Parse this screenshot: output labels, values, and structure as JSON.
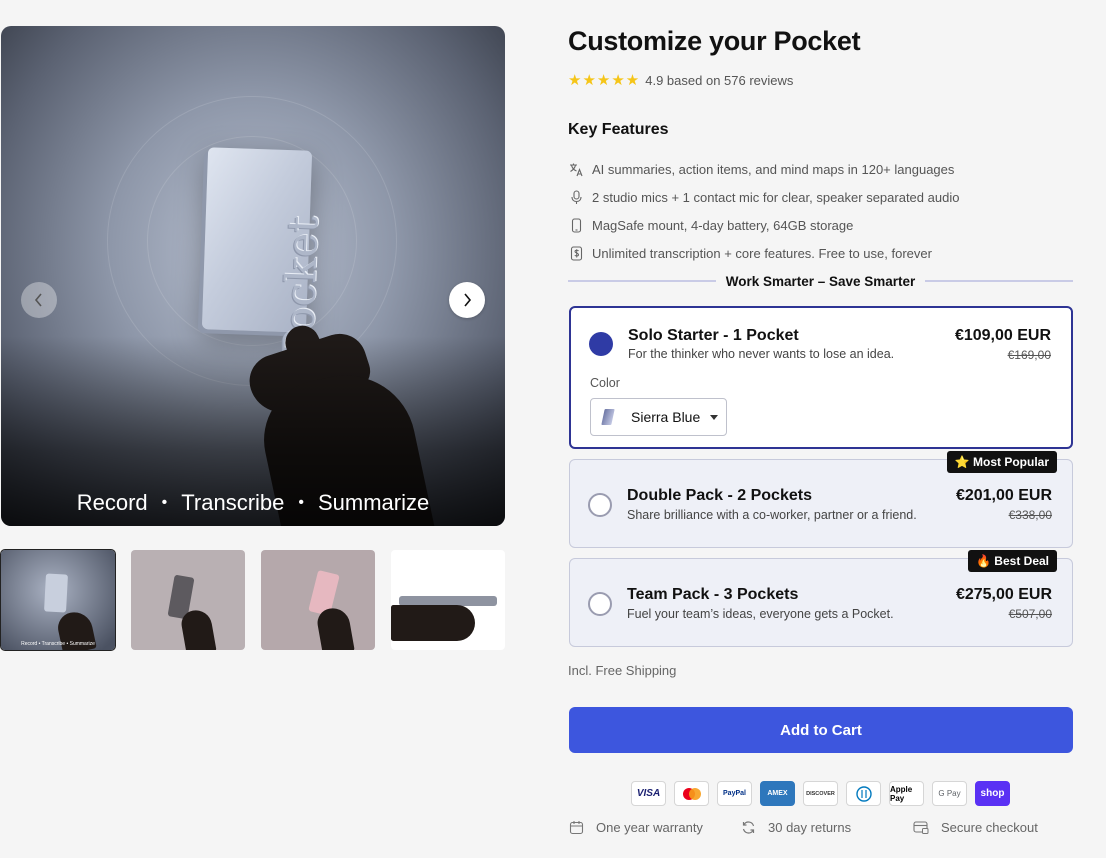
{
  "gallery": {
    "hero_tagline": [
      "Record",
      "Transcribe",
      "Summarize"
    ],
    "tagline_separator": "•",
    "device_wordmark": "Pocket",
    "thumb1_caption": "Record • Transcribe • Summarize",
    "prev_icon": "chevron-left-icon",
    "next_icon": "chevron-right-icon"
  },
  "product": {
    "title": "Customize your Pocket",
    "stars": "★★★★★",
    "rating_text": "4.9 based on 576 reviews"
  },
  "key_features": {
    "title": "Key Features",
    "items": [
      {
        "icon": "translate-icon",
        "text": "AI summaries, action items, and mind maps in 120+ languages"
      },
      {
        "icon": "microphone-icon",
        "text": "2 studio mics + 1 contact mic for clear, speaker separated audio"
      },
      {
        "icon": "phone-icon",
        "text": "MagSafe mount, 4-day battery, 64GB storage"
      },
      {
        "icon": "dollar-icon",
        "text": "Unlimited transcription + core features. Free to use, forever"
      }
    ]
  },
  "offer_divider": "Work Smarter – Save Smarter",
  "plans": [
    {
      "name": "Solo Starter - 1 Pocket",
      "desc": "For the thinker who never wants to lose an idea.",
      "price": "€109,00 EUR",
      "old_price": "€169,00",
      "selected": true,
      "badge": ""
    },
    {
      "name": "Double Pack - 2 Pockets",
      "desc": "Share brilliance with a co-worker, partner or a friend.",
      "price": "€201,00 EUR",
      "old_price": "€338,00",
      "selected": false,
      "badge": "⭐ Most Popular"
    },
    {
      "name": "Team Pack - 3 Pockets",
      "desc": "Fuel your team’s ideas, everyone gets a Pocket.",
      "price": "€275,00 EUR",
      "old_price": "€507,00",
      "selected": false,
      "badge": "🔥 Best Deal"
    }
  ],
  "color_picker": {
    "label": "Color",
    "value": "Sierra Blue"
  },
  "shipping_note": "Incl. Free Shipping",
  "cart_button": "Add to Cart",
  "payment_methods": [
    "VISA",
    "Mastercard",
    "PayPal",
    "AMEX",
    "DISCOVER",
    "Diners",
    "Apple Pay",
    "G Pay",
    "shop"
  ],
  "trust": [
    {
      "icon": "calendar-icon",
      "text": "One year warranty"
    },
    {
      "icon": "refresh-icon",
      "text": "30 day returns"
    },
    {
      "icon": "secure-card-icon",
      "text": "Secure checkout"
    }
  ],
  "colors": {
    "accent": "#3d56de",
    "selected_border": "#2e3494",
    "radio_on": "#2f3ba5",
    "star": "#f5c518",
    "shop_pay": "#5a31f4"
  }
}
